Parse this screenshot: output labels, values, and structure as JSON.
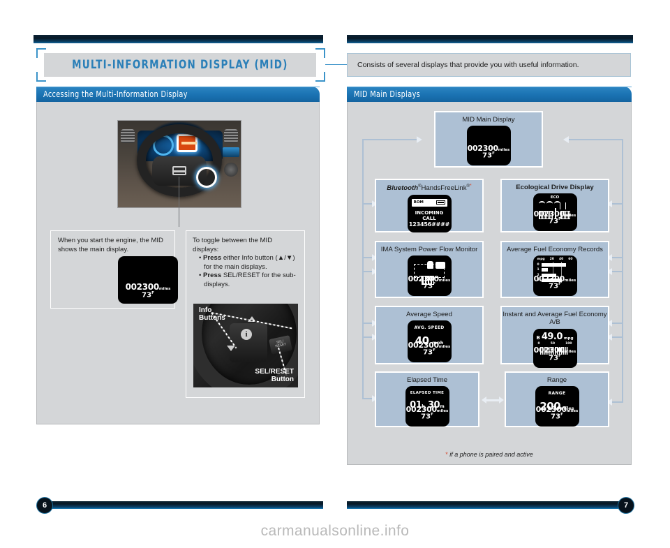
{
  "header": {
    "title": "MULTI-INFORMATION DISPLAY (MID)",
    "intro_note": "Consists of several displays that provide you with useful information."
  },
  "left_panel": {
    "section_title": "Accessing the Multi-Information Display",
    "box_a": {
      "text": "When you start the engine, the MID shows the main display.",
      "screen": {
        "odometer": "002300",
        "odometer_unit": "miles",
        "temp": "73",
        "temp_unit": "F"
      }
    },
    "box_b": {
      "intro": "To toggle between the MID displays:",
      "bullets": [
        {
          "bold": "Press",
          "rest": " either Info button (▲/▼) for the main displays."
        },
        {
          "bold": "Press",
          "rest": " SEL/RESET for the sub-displays."
        }
      ],
      "photo_labels": {
        "info_buttons": "Info\nButtons",
        "sel_reset": "SEL/RESET\nButton",
        "sel_reset_key": "SEL/\nRESET"
      }
    },
    "page_number": "6"
  },
  "right_panel": {
    "section_title": "MID Main Displays",
    "footnote_asterisk": "*",
    "footnote": "if a phone is paired and active",
    "page_number": "7",
    "nodes": [
      {
        "id": "mid-main-display",
        "title": "MID Main Display",
        "screen": {
          "odometer": "002300",
          "odometer_unit": "miles",
          "temp": "73",
          "temp_unit": "F"
        }
      },
      {
        "id": "bluetooth-handsfreelink",
        "title_parts": {
          "italic": "Bluetooth",
          "reg1": "®",
          "plain": "HandsFreeLink",
          "reg2": "®",
          "asterisk": "*"
        },
        "status_left": "ROM",
        "line1": "INCOMING",
        "line2": "CALL",
        "number": "123456####"
      },
      {
        "id": "ecological-drive-display",
        "title": "Ecological Drive Display",
        "eco_label": "ECO",
        "screen": {
          "odometer": "002300",
          "odometer_unit": "miles",
          "temp": "73",
          "temp_unit": "F"
        }
      },
      {
        "id": "ima-system-power-flow-monitor",
        "title": "IMA System Power Flow Monitor",
        "screen": {
          "odometer": "002300",
          "odometer_unit": "miles",
          "temp": "73",
          "temp_unit": "F"
        }
      },
      {
        "id": "average-fuel-economy-records",
        "title": "Average Fuel Economy Records",
        "axis_label": "mpg",
        "axis_ticks": [
          "20",
          "40",
          "60"
        ],
        "row_labels": [
          "0",
          "1",
          "2",
          "3"
        ],
        "screen": {
          "odometer": "002300",
          "odometer_unit": "miles",
          "temp": "73",
          "temp_unit": "F"
        }
      },
      {
        "id": "average-speed",
        "title": "Average Speed",
        "caption": "AVG. SPEED",
        "value": "40",
        "unit": "mph",
        "screen": {
          "odometer": "002300",
          "odometer_unit": "miles",
          "temp": "73",
          "temp_unit": "F"
        }
      },
      {
        "id": "instant-and-average-fuel-economy",
        "title": "Instant and Average Fuel Economy A/B",
        "mode": "B",
        "value": "49.0",
        "unit": "mpg",
        "scale": [
          "0",
          "50",
          "100"
        ],
        "screen": {
          "odometer": "002300",
          "odometer_unit": "miles",
          "temp": "73",
          "temp_unit": "F"
        }
      },
      {
        "id": "elapsed-time",
        "title": "Elapsed Time",
        "caption": "ELAPSED TIME",
        "hours": "01",
        "hours_unit": "h",
        "minutes": "30",
        "minutes_unit": "m",
        "screen": {
          "odometer": "002300",
          "odometer_unit": "miles",
          "temp": "73",
          "temp_unit": "F"
        }
      },
      {
        "id": "range",
        "title": "Range",
        "caption": "RANGE",
        "value": "200",
        "unit": "miles",
        "screen": {
          "odometer": "002300",
          "odometer_unit": "miles",
          "temp": "73",
          "temp_unit": "F"
        }
      }
    ]
  },
  "chart_data": {
    "type": "bar",
    "title": "Average Fuel Economy Records",
    "xlabel": "mpg",
    "ylabel": "",
    "categories": [
      "0",
      "1",
      "2",
      "3"
    ],
    "values": [
      52,
      14,
      32,
      45
    ],
    "xlim": [
      0,
      70
    ],
    "ticks": [
      20,
      40,
      60
    ],
    "grid": true,
    "legend": "none",
    "orientation": "horizontal"
  },
  "watermark": "carmanualsonline.info"
}
